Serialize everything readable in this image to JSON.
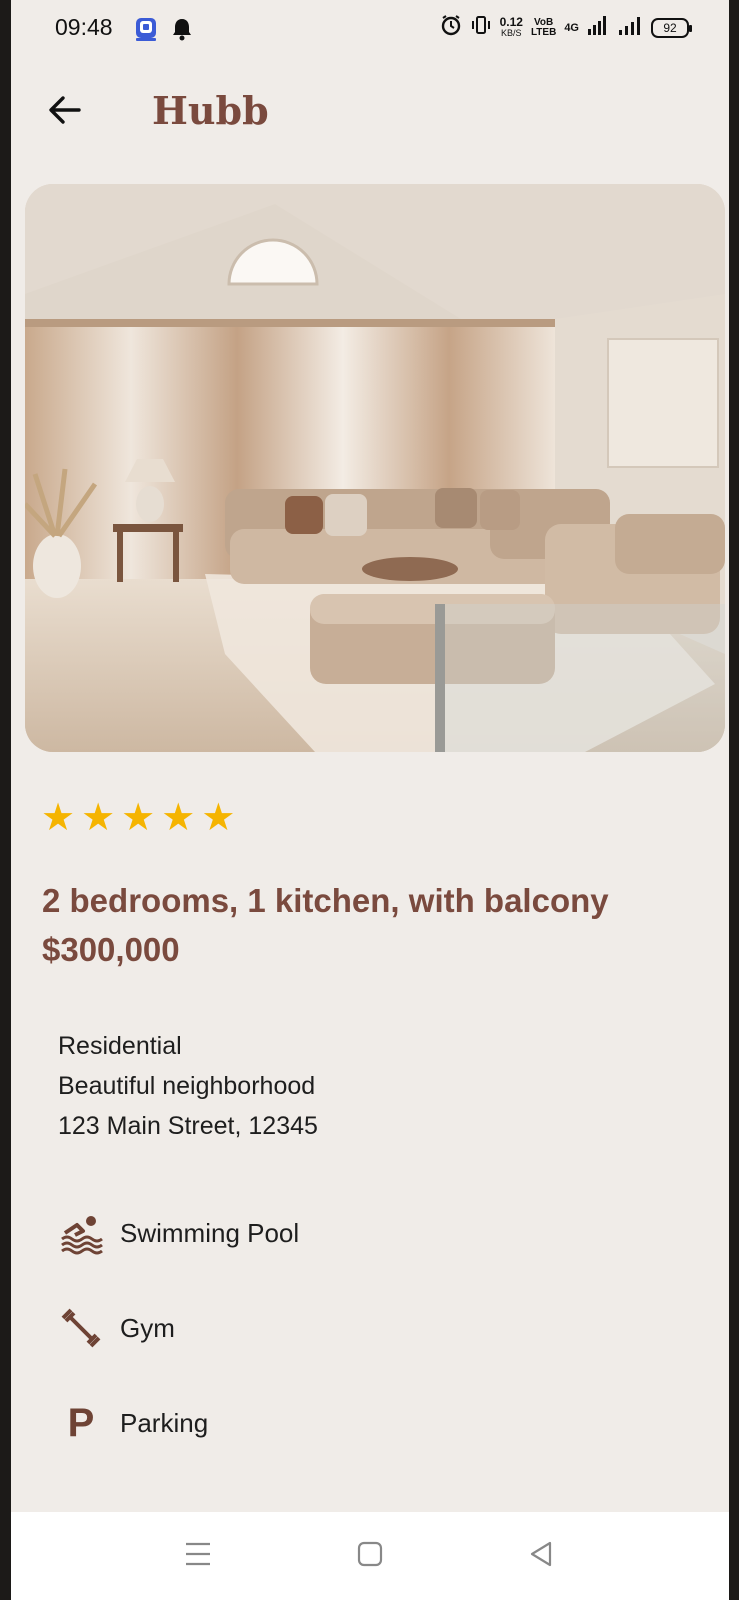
{
  "status_bar": {
    "time": "09:48",
    "net_speed_value": "0.12",
    "net_speed_unit": "KB/S",
    "volte_top": "VoB",
    "volte_bottom": "LTEB",
    "network": "4G",
    "battery": "92"
  },
  "app_bar": {
    "title": "Hubb",
    "back_icon": "arrow-left-icon"
  },
  "listing": {
    "image": "living-room-photo",
    "rating": 5,
    "rating_stars": [
      "★",
      "★",
      "★",
      "★",
      "★"
    ],
    "headline": "2 bedrooms, 1 kitchen, with balcony",
    "price": "$300,000",
    "type": "Residential",
    "description": "Beautiful neighborhood",
    "address": "123 Main Street, 12345"
  },
  "amenities": [
    {
      "label": "Swimming Pool",
      "icon": "pool-icon"
    },
    {
      "label": "Gym",
      "icon": "dumbbell-icon"
    },
    {
      "label": "Parking",
      "icon": "parking-icon",
      "glyph": "P"
    }
  ],
  "colors": {
    "accent": "#7a4a3e",
    "background": "#f0ece8",
    "star": "#f5b400"
  }
}
